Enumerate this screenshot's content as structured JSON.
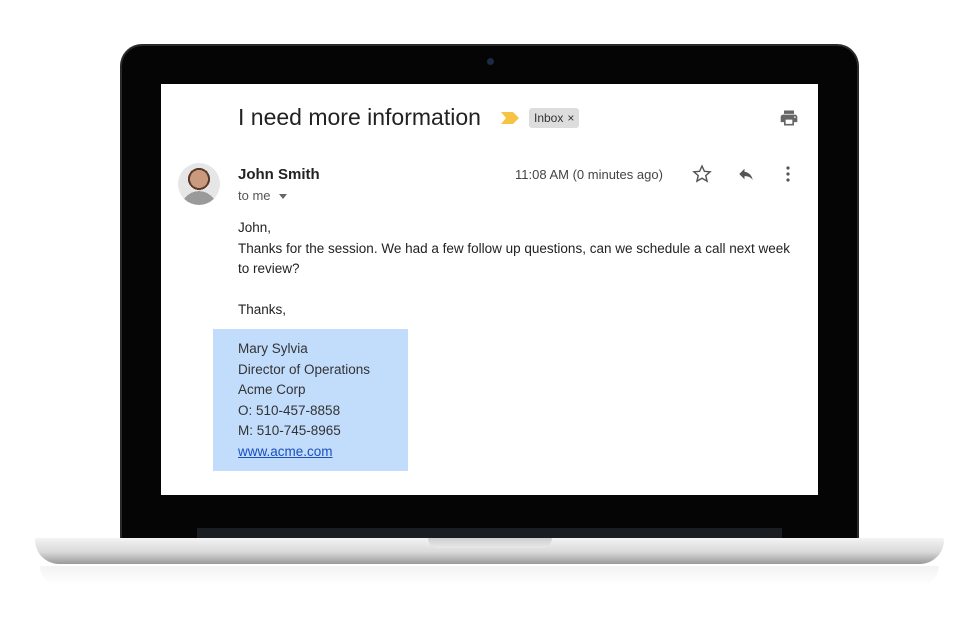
{
  "email": {
    "subject": "I need more information",
    "label": "Inbox",
    "label_remove": "×",
    "sender": "John Smith",
    "recipient": "to me",
    "time": "11:08 AM (0 minutes ago)",
    "body": {
      "greeting": "John,",
      "line1": "Thanks for the session.   We had a few follow up questions, can we schedule a call next week to review?",
      "closing": "Thanks,"
    },
    "signature": {
      "name": "Mary Sylvia",
      "title": "Director of Operations",
      "company": "Acme Corp",
      "office": "O: 510-457-8858",
      "mobile": "M: 510-745-8965",
      "website": "www.acme.com"
    }
  },
  "colors": {
    "importance": "#f6c343",
    "signature_highlight": "#c2dcfc",
    "link": "#1a4fbf"
  },
  "icons": [
    "important-marker-icon",
    "print-icon",
    "star-icon",
    "reply-icon",
    "more-vert-icon",
    "chevron-down-icon"
  ]
}
